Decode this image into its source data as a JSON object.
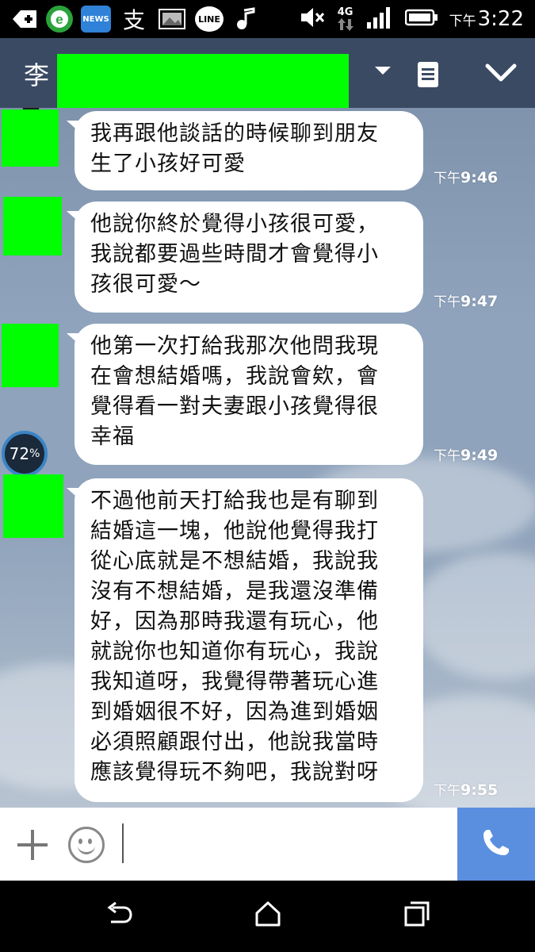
{
  "status_bar": {
    "left_icons": [
      {
        "icon": "plus-badge-icon",
        "text": ""
      },
      {
        "icon": "browser-e-icon",
        "text": ""
      },
      {
        "icon": "news-app-icon",
        "text": "NEWS"
      },
      {
        "icon": "zhi-app-icon",
        "text": "支"
      },
      {
        "icon": "gallery-icon",
        "text": ""
      },
      {
        "icon": "line-app-icon",
        "text": "LINE"
      },
      {
        "icon": "music-note-icon",
        "text": ""
      }
    ],
    "network": "4G",
    "time_prefix": "下午",
    "time": "3:22"
  },
  "header": {
    "title_visible": "李"
  },
  "battery_overlay": {
    "value": "72",
    "unit": "%"
  },
  "messages": [
    {
      "text_lines": [
        "我再跟他談話的時候聊到朋友",
        "生了小孩好可愛"
      ],
      "time_prefix": "下午",
      "time": "9:46"
    },
    {
      "text_lines": [
        "他說你終於覺得小孩很可愛，",
        "我說都要過些時間才會覺得小",
        "孩很可愛～"
      ],
      "time_prefix": "下午",
      "time": "9:47"
    },
    {
      "text_lines": [
        "他第一次打給我那次他問我現",
        "在會想結婚嗎，我說會欸，會",
        "覺得看一對夫妻跟小孩覺得很",
        "幸福"
      ],
      "time_prefix": "下午",
      "time": "9:49"
    },
    {
      "text_lines": [
        "不過他前天打給我也是有聊到",
        "結婚這一塊，他說他覺得我打",
        "從心底就是不想結婚，我說我",
        "沒有不想結婚，是我還沒準備",
        "好，因為那時我還有玩心，他",
        "就說你也知道你有玩心，我說",
        "我知道呀，我覺得帶著玩心進",
        "到婚姻很不好，因為進到婚姻",
        "必須照顧跟付出，他說我當時",
        "應該覺得玩不夠吧，我說對呀"
      ],
      "time_prefix": "下午",
      "time": "9:55"
    }
  ],
  "colors": {
    "header": "#3b4a63",
    "redaction": "#00ff00",
    "call_button": "#5a8fe0"
  }
}
